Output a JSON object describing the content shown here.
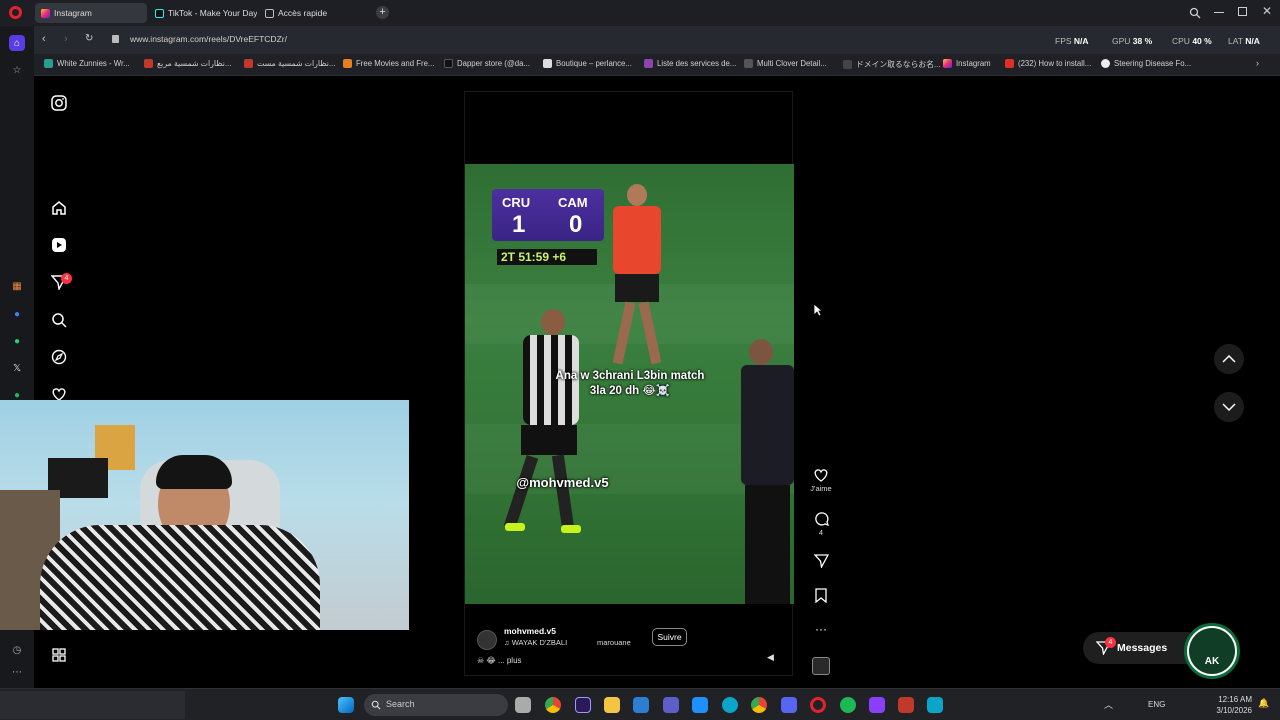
{
  "tabs": [
    {
      "label": "Instagram",
      "active": true
    },
    {
      "label": "TikTok - Make Your Day",
      "active": false
    },
    {
      "label": "Accès rapide",
      "active": false
    }
  ],
  "address": {
    "url": "www.instagram.com/reels/DVreEFTCDZr/"
  },
  "stats": {
    "fps": "FPS",
    "fps_val": "N/A",
    "gpu": "GPU",
    "gpu_val": "38 %",
    "cpu": "CPU",
    "cpu_val": "40 %",
    "lat": "LAT",
    "lat_val": "N/A"
  },
  "bookmarks": [
    "White Zunnies - Wr...",
    "نظارات شمسية مربع...",
    "نظارات شمسية مست...",
    "Free Movies and Fre...",
    "Dapper store (@da...",
    "Boutique – perlance...",
    "Liste des services de...",
    "Multi Clover Detail...",
    "ドメイン取るならお名...",
    "Instagram",
    "(232) How to install...",
    "Steering Disease Fo..."
  ],
  "ig": {
    "notif_count": "4",
    "score": {
      "home": "CRU",
      "away": "CAM",
      "home_goals": "1",
      "away_goals": "0",
      "clock": "2T 51:59",
      "added": "+6"
    },
    "caption_line1": "Ana w 3chrani L3bin match",
    "caption_line2": "3la 20 dh 😂☠️",
    "watermark": "@mohvmed.v5",
    "author": "mohvmed.v5",
    "audio": "WAYAK D'ZBALI",
    "tagged": "marouane",
    "follow": "Suivre",
    "desc": "... plus",
    "like_label": "J'aime",
    "comment_count": "4",
    "messages_label": "Messages",
    "messages_count": "4",
    "ak_label": "AK"
  },
  "taskbar": {
    "search": "Search",
    "lang": "ENG",
    "time": "12:16 AM",
    "date": "3/10/2026"
  }
}
